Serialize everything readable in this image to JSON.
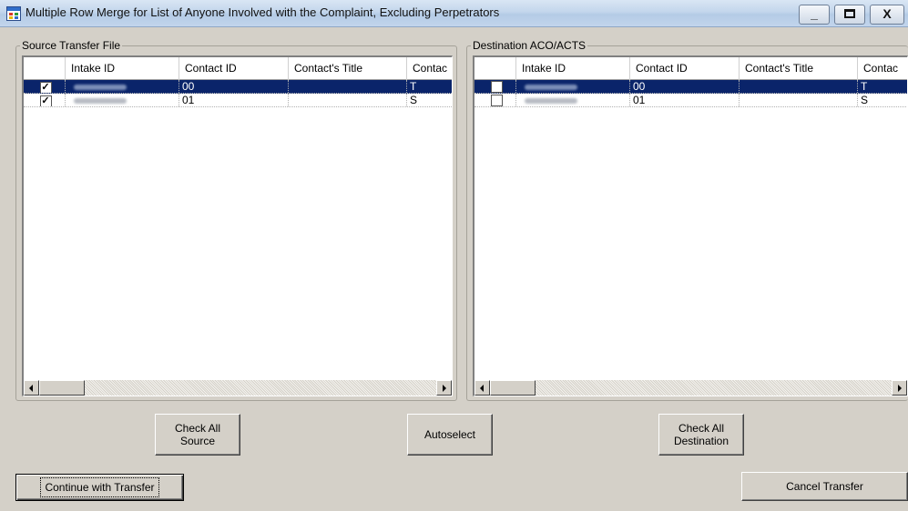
{
  "window": {
    "title": "Multiple Row Merge for List of Anyone Involved with the Complaint, Excluding Perpetrators",
    "controls": {
      "minimize": "_",
      "maximize": "□",
      "close": "X"
    }
  },
  "source": {
    "caption": "Source Transfer File",
    "columns": [
      "",
      "Intake ID",
      "Contact ID",
      "Contact's Title",
      "Contac"
    ],
    "rows": [
      {
        "checked": true,
        "intake_id": "",
        "contact_id": "00",
        "title": "",
        "contact": "T",
        "selected": true
      },
      {
        "checked": true,
        "intake_id": "",
        "contact_id": "01",
        "title": "",
        "contact": "S",
        "selected": false
      }
    ]
  },
  "destination": {
    "caption": "Destination ACO/ACTS",
    "columns": [
      "",
      "Intake ID",
      "Contact ID",
      "Contact's Title",
      "Contac"
    ],
    "rows": [
      {
        "checked": false,
        "intake_id": "",
        "contact_id": "00",
        "title": "",
        "contact": "T",
        "selected": true
      },
      {
        "checked": false,
        "intake_id": "",
        "contact_id": "01",
        "title": "",
        "contact": "S",
        "selected": false
      }
    ]
  },
  "buttons": {
    "check_all_source": "Check All\nSource",
    "autoselect": "Autoselect",
    "check_all_destination": "Check All\nDestination",
    "continue": "Continue with Transfer",
    "cancel": "Cancel Transfer"
  },
  "colors": {
    "selection": "#0a246a",
    "face": "#d4d0c8"
  }
}
